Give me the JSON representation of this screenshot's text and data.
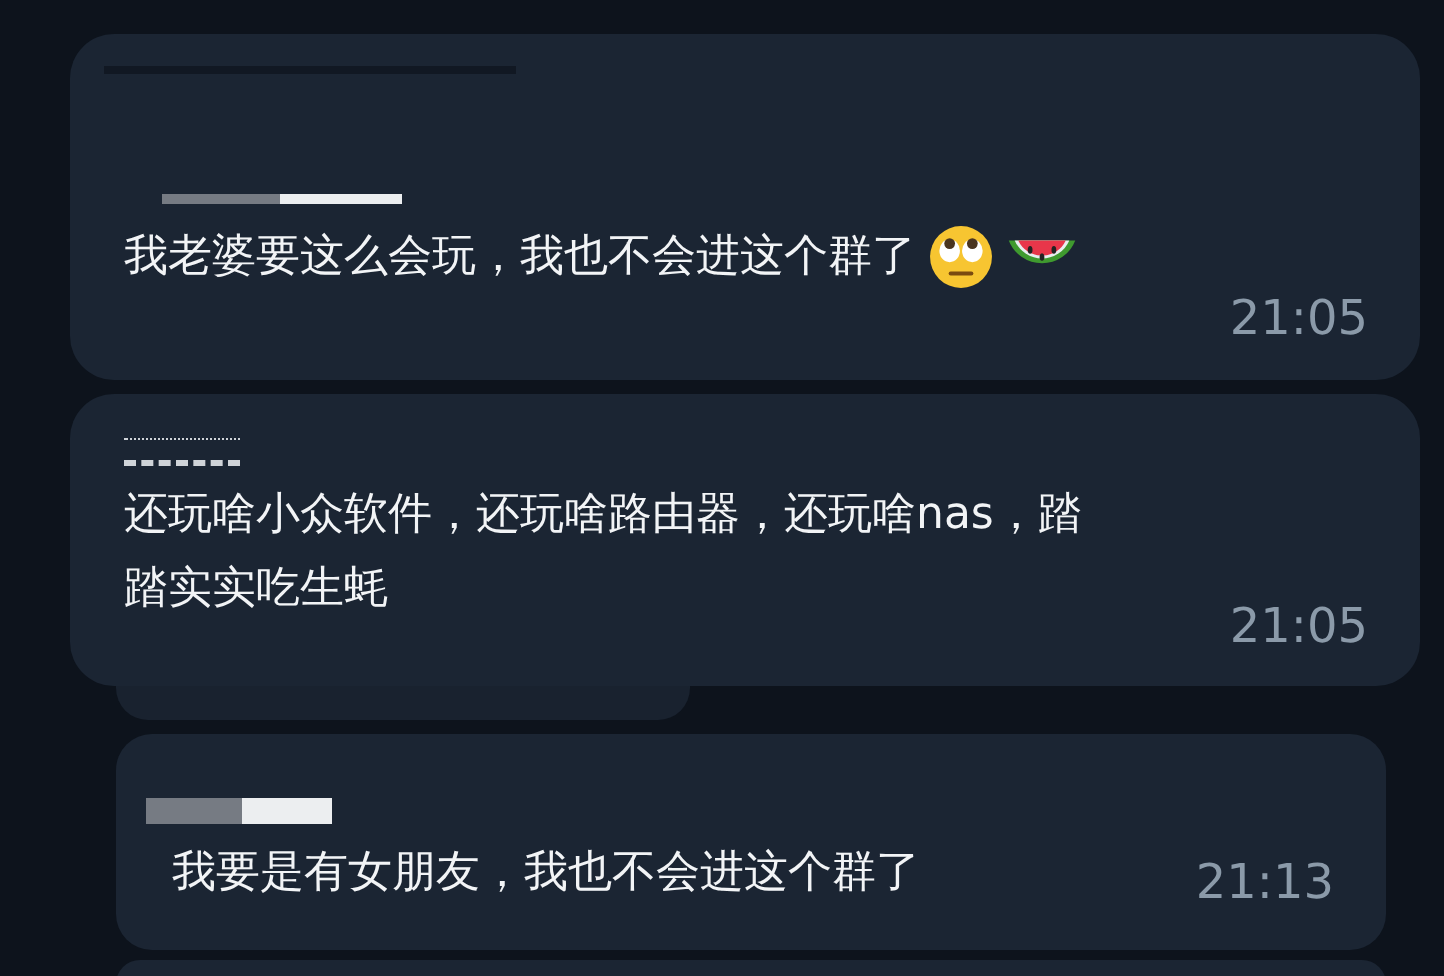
{
  "messages": [
    {
      "kind": "full",
      "lines": [
        "我老婆要这么会玩，我也不会进这个群了"
      ],
      "emojis": [
        {
          "kind": "eyeroll"
        },
        {
          "kind": "watermelon"
        }
      ],
      "time": "21:05"
    },
    {
      "kind": "full",
      "lines": [
        "还玩啥小众软件，还玩啥路由器，还玩啥nas，踏",
        "踏实实吃生蚝"
      ],
      "time": "21:05"
    },
    {
      "kind": "stub"
    },
    {
      "kind": "full",
      "indent": true,
      "lines": [
        "我要是有女朋友，我也不会进这个群了"
      ],
      "time": "21:13"
    },
    {
      "kind": "edge",
      "indent": true
    }
  ]
}
